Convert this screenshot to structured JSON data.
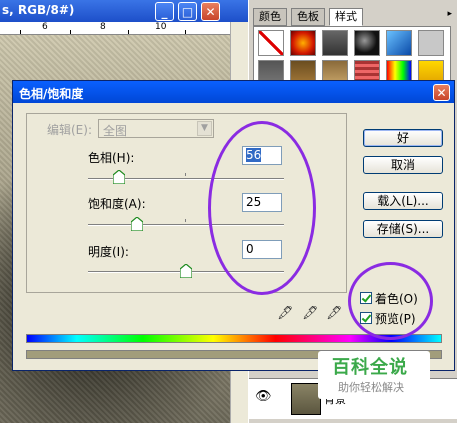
{
  "document": {
    "title": "s, RGB/8#)",
    "ruler_ticks": [
      "6",
      "8",
      "10"
    ]
  },
  "styles_panel": {
    "tabs": [
      "颜色",
      "色板",
      "样式"
    ],
    "active_tab": "样式",
    "menu_glyph": "▸",
    "layer_name": "背景"
  },
  "dialog": {
    "title": "色相/饱和度",
    "close_glyph": "✕",
    "edit_label": "编辑(E):",
    "edit_value": "全图",
    "hue_label": "色相(H):",
    "hue_value": "56",
    "saturation_label": "饱和度(A):",
    "saturation_value": "25",
    "lightness_label": "明度(I):",
    "lightness_value": "0",
    "buttons": {
      "ok": "好",
      "cancel": "取消",
      "load": "载入(L)...",
      "save": "存储(S)..."
    },
    "colorize_label": "着色(O)",
    "preview_label": "预览(P)",
    "colorize_checked": true,
    "preview_checked": true,
    "slider_levels": {
      "hue": 0.16,
      "saturation": 0.25,
      "lightness": 0.5
    },
    "colorized_strip_color": "#a29d7b"
  },
  "watermark": {
    "line1": "百科全说",
    "line2": "助你轻松解决"
  },
  "colors": {
    "annotation": "#8a2be2",
    "titlebar": "#0054e3"
  }
}
